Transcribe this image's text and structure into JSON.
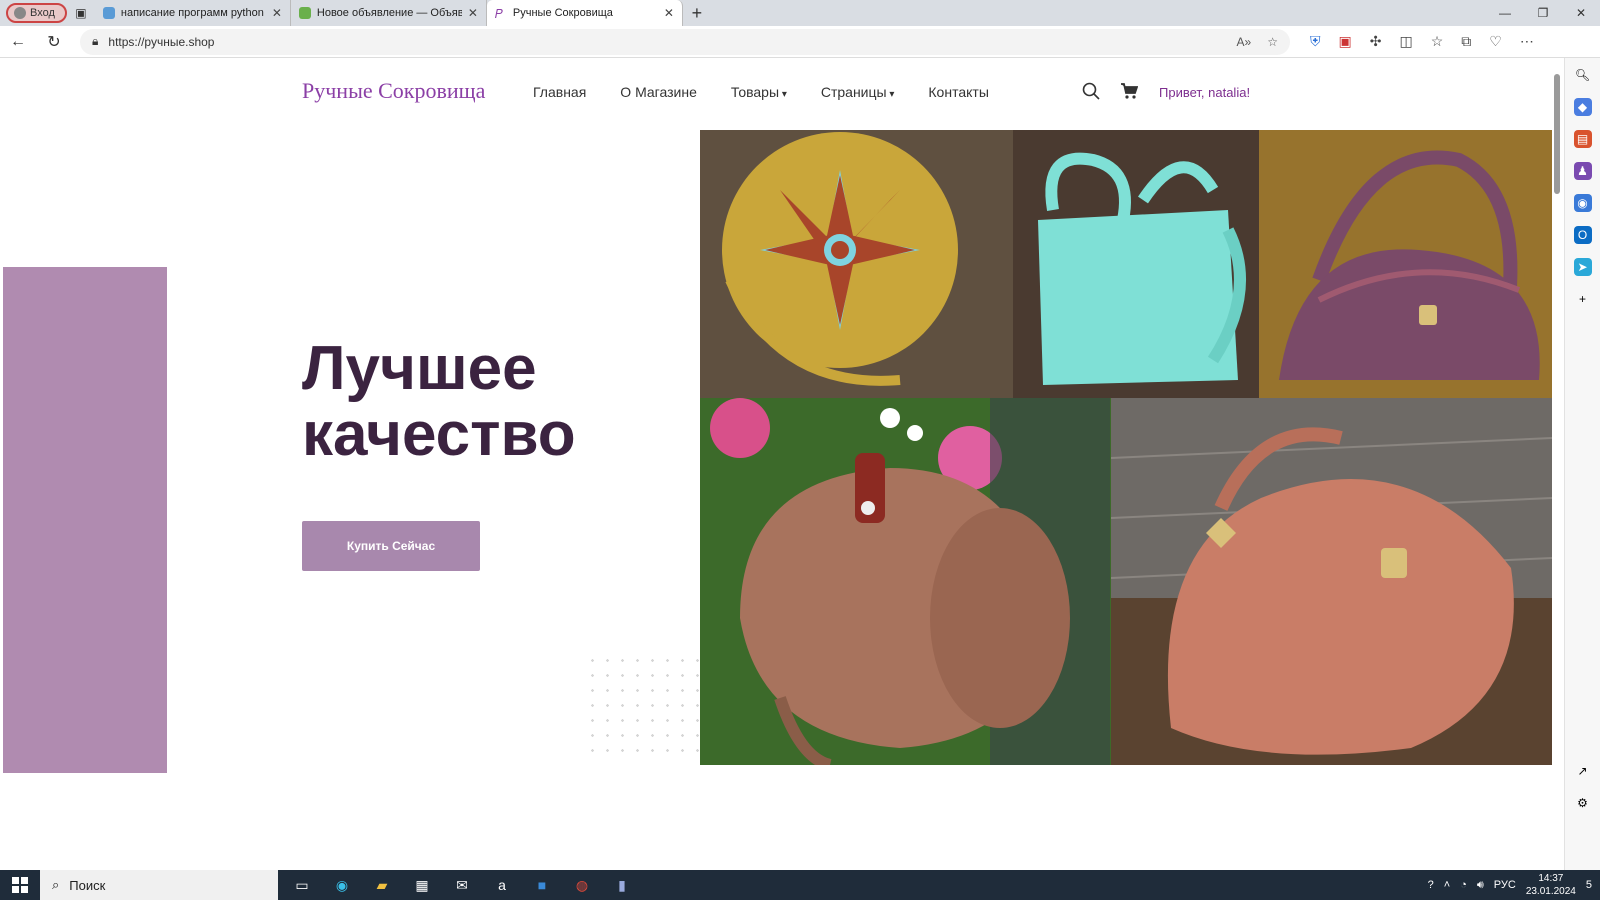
{
  "browser": {
    "profile_label": "Вход",
    "tabs": [
      {
        "title": "написание программ python - ​"
      },
      {
        "title": "Новое объявление — Объявле"
      },
      {
        "title": "Ручные Сокровища"
      }
    ],
    "url": "https://ручные.shop"
  },
  "site": {
    "logo": "Ручные Сокровища",
    "nav": [
      "Главная",
      "О Магазине",
      "Товары",
      "Страницы",
      "Контакты"
    ],
    "greeting": "Привет, natalia!",
    "hero_title_line1": "Лучшее",
    "hero_title_line2": "качество",
    "buy_button": "Купить Сейчас",
    "accent_color": "#b08bb0"
  },
  "taskbar": {
    "search_label": "Поиск",
    "lang": "РУС",
    "time": "14:37",
    "date": "23.01.2024",
    "notifications": "5"
  }
}
